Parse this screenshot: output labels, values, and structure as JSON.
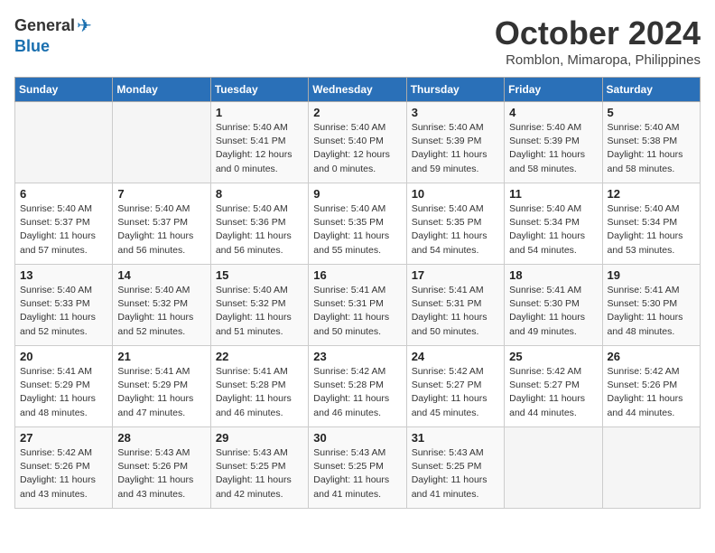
{
  "header": {
    "logo_general": "General",
    "logo_blue": "Blue",
    "month_title": "October 2024",
    "location": "Romblon, Mimaropa, Philippines"
  },
  "columns": [
    "Sunday",
    "Monday",
    "Tuesday",
    "Wednesday",
    "Thursday",
    "Friday",
    "Saturday"
  ],
  "weeks": [
    [
      {
        "day": "",
        "info": ""
      },
      {
        "day": "",
        "info": ""
      },
      {
        "day": "1",
        "info": "Sunrise: 5:40 AM\nSunset: 5:41 PM\nDaylight: 12 hours\nand 0 minutes."
      },
      {
        "day": "2",
        "info": "Sunrise: 5:40 AM\nSunset: 5:40 PM\nDaylight: 12 hours\nand 0 minutes."
      },
      {
        "day": "3",
        "info": "Sunrise: 5:40 AM\nSunset: 5:39 PM\nDaylight: 11 hours\nand 59 minutes."
      },
      {
        "day": "4",
        "info": "Sunrise: 5:40 AM\nSunset: 5:39 PM\nDaylight: 11 hours\nand 58 minutes."
      },
      {
        "day": "5",
        "info": "Sunrise: 5:40 AM\nSunset: 5:38 PM\nDaylight: 11 hours\nand 58 minutes."
      }
    ],
    [
      {
        "day": "6",
        "info": "Sunrise: 5:40 AM\nSunset: 5:37 PM\nDaylight: 11 hours\nand 57 minutes."
      },
      {
        "day": "7",
        "info": "Sunrise: 5:40 AM\nSunset: 5:37 PM\nDaylight: 11 hours\nand 56 minutes."
      },
      {
        "day": "8",
        "info": "Sunrise: 5:40 AM\nSunset: 5:36 PM\nDaylight: 11 hours\nand 56 minutes."
      },
      {
        "day": "9",
        "info": "Sunrise: 5:40 AM\nSunset: 5:35 PM\nDaylight: 11 hours\nand 55 minutes."
      },
      {
        "day": "10",
        "info": "Sunrise: 5:40 AM\nSunset: 5:35 PM\nDaylight: 11 hours\nand 54 minutes."
      },
      {
        "day": "11",
        "info": "Sunrise: 5:40 AM\nSunset: 5:34 PM\nDaylight: 11 hours\nand 54 minutes."
      },
      {
        "day": "12",
        "info": "Sunrise: 5:40 AM\nSunset: 5:34 PM\nDaylight: 11 hours\nand 53 minutes."
      }
    ],
    [
      {
        "day": "13",
        "info": "Sunrise: 5:40 AM\nSunset: 5:33 PM\nDaylight: 11 hours\nand 52 minutes."
      },
      {
        "day": "14",
        "info": "Sunrise: 5:40 AM\nSunset: 5:32 PM\nDaylight: 11 hours\nand 52 minutes."
      },
      {
        "day": "15",
        "info": "Sunrise: 5:40 AM\nSunset: 5:32 PM\nDaylight: 11 hours\nand 51 minutes."
      },
      {
        "day": "16",
        "info": "Sunrise: 5:41 AM\nSunset: 5:31 PM\nDaylight: 11 hours\nand 50 minutes."
      },
      {
        "day": "17",
        "info": "Sunrise: 5:41 AM\nSunset: 5:31 PM\nDaylight: 11 hours\nand 50 minutes."
      },
      {
        "day": "18",
        "info": "Sunrise: 5:41 AM\nSunset: 5:30 PM\nDaylight: 11 hours\nand 49 minutes."
      },
      {
        "day": "19",
        "info": "Sunrise: 5:41 AM\nSunset: 5:30 PM\nDaylight: 11 hours\nand 48 minutes."
      }
    ],
    [
      {
        "day": "20",
        "info": "Sunrise: 5:41 AM\nSunset: 5:29 PM\nDaylight: 11 hours\nand 48 minutes."
      },
      {
        "day": "21",
        "info": "Sunrise: 5:41 AM\nSunset: 5:29 PM\nDaylight: 11 hours\nand 47 minutes."
      },
      {
        "day": "22",
        "info": "Sunrise: 5:41 AM\nSunset: 5:28 PM\nDaylight: 11 hours\nand 46 minutes."
      },
      {
        "day": "23",
        "info": "Sunrise: 5:42 AM\nSunset: 5:28 PM\nDaylight: 11 hours\nand 46 minutes."
      },
      {
        "day": "24",
        "info": "Sunrise: 5:42 AM\nSunset: 5:27 PM\nDaylight: 11 hours\nand 45 minutes."
      },
      {
        "day": "25",
        "info": "Sunrise: 5:42 AM\nSunset: 5:27 PM\nDaylight: 11 hours\nand 44 minutes."
      },
      {
        "day": "26",
        "info": "Sunrise: 5:42 AM\nSunset: 5:26 PM\nDaylight: 11 hours\nand 44 minutes."
      }
    ],
    [
      {
        "day": "27",
        "info": "Sunrise: 5:42 AM\nSunset: 5:26 PM\nDaylight: 11 hours\nand 43 minutes."
      },
      {
        "day": "28",
        "info": "Sunrise: 5:43 AM\nSunset: 5:26 PM\nDaylight: 11 hours\nand 43 minutes."
      },
      {
        "day": "29",
        "info": "Sunrise: 5:43 AM\nSunset: 5:25 PM\nDaylight: 11 hours\nand 42 minutes."
      },
      {
        "day": "30",
        "info": "Sunrise: 5:43 AM\nSunset: 5:25 PM\nDaylight: 11 hours\nand 41 minutes."
      },
      {
        "day": "31",
        "info": "Sunrise: 5:43 AM\nSunset: 5:25 PM\nDaylight: 11 hours\nand 41 minutes."
      },
      {
        "day": "",
        "info": ""
      },
      {
        "day": "",
        "info": ""
      }
    ]
  ]
}
